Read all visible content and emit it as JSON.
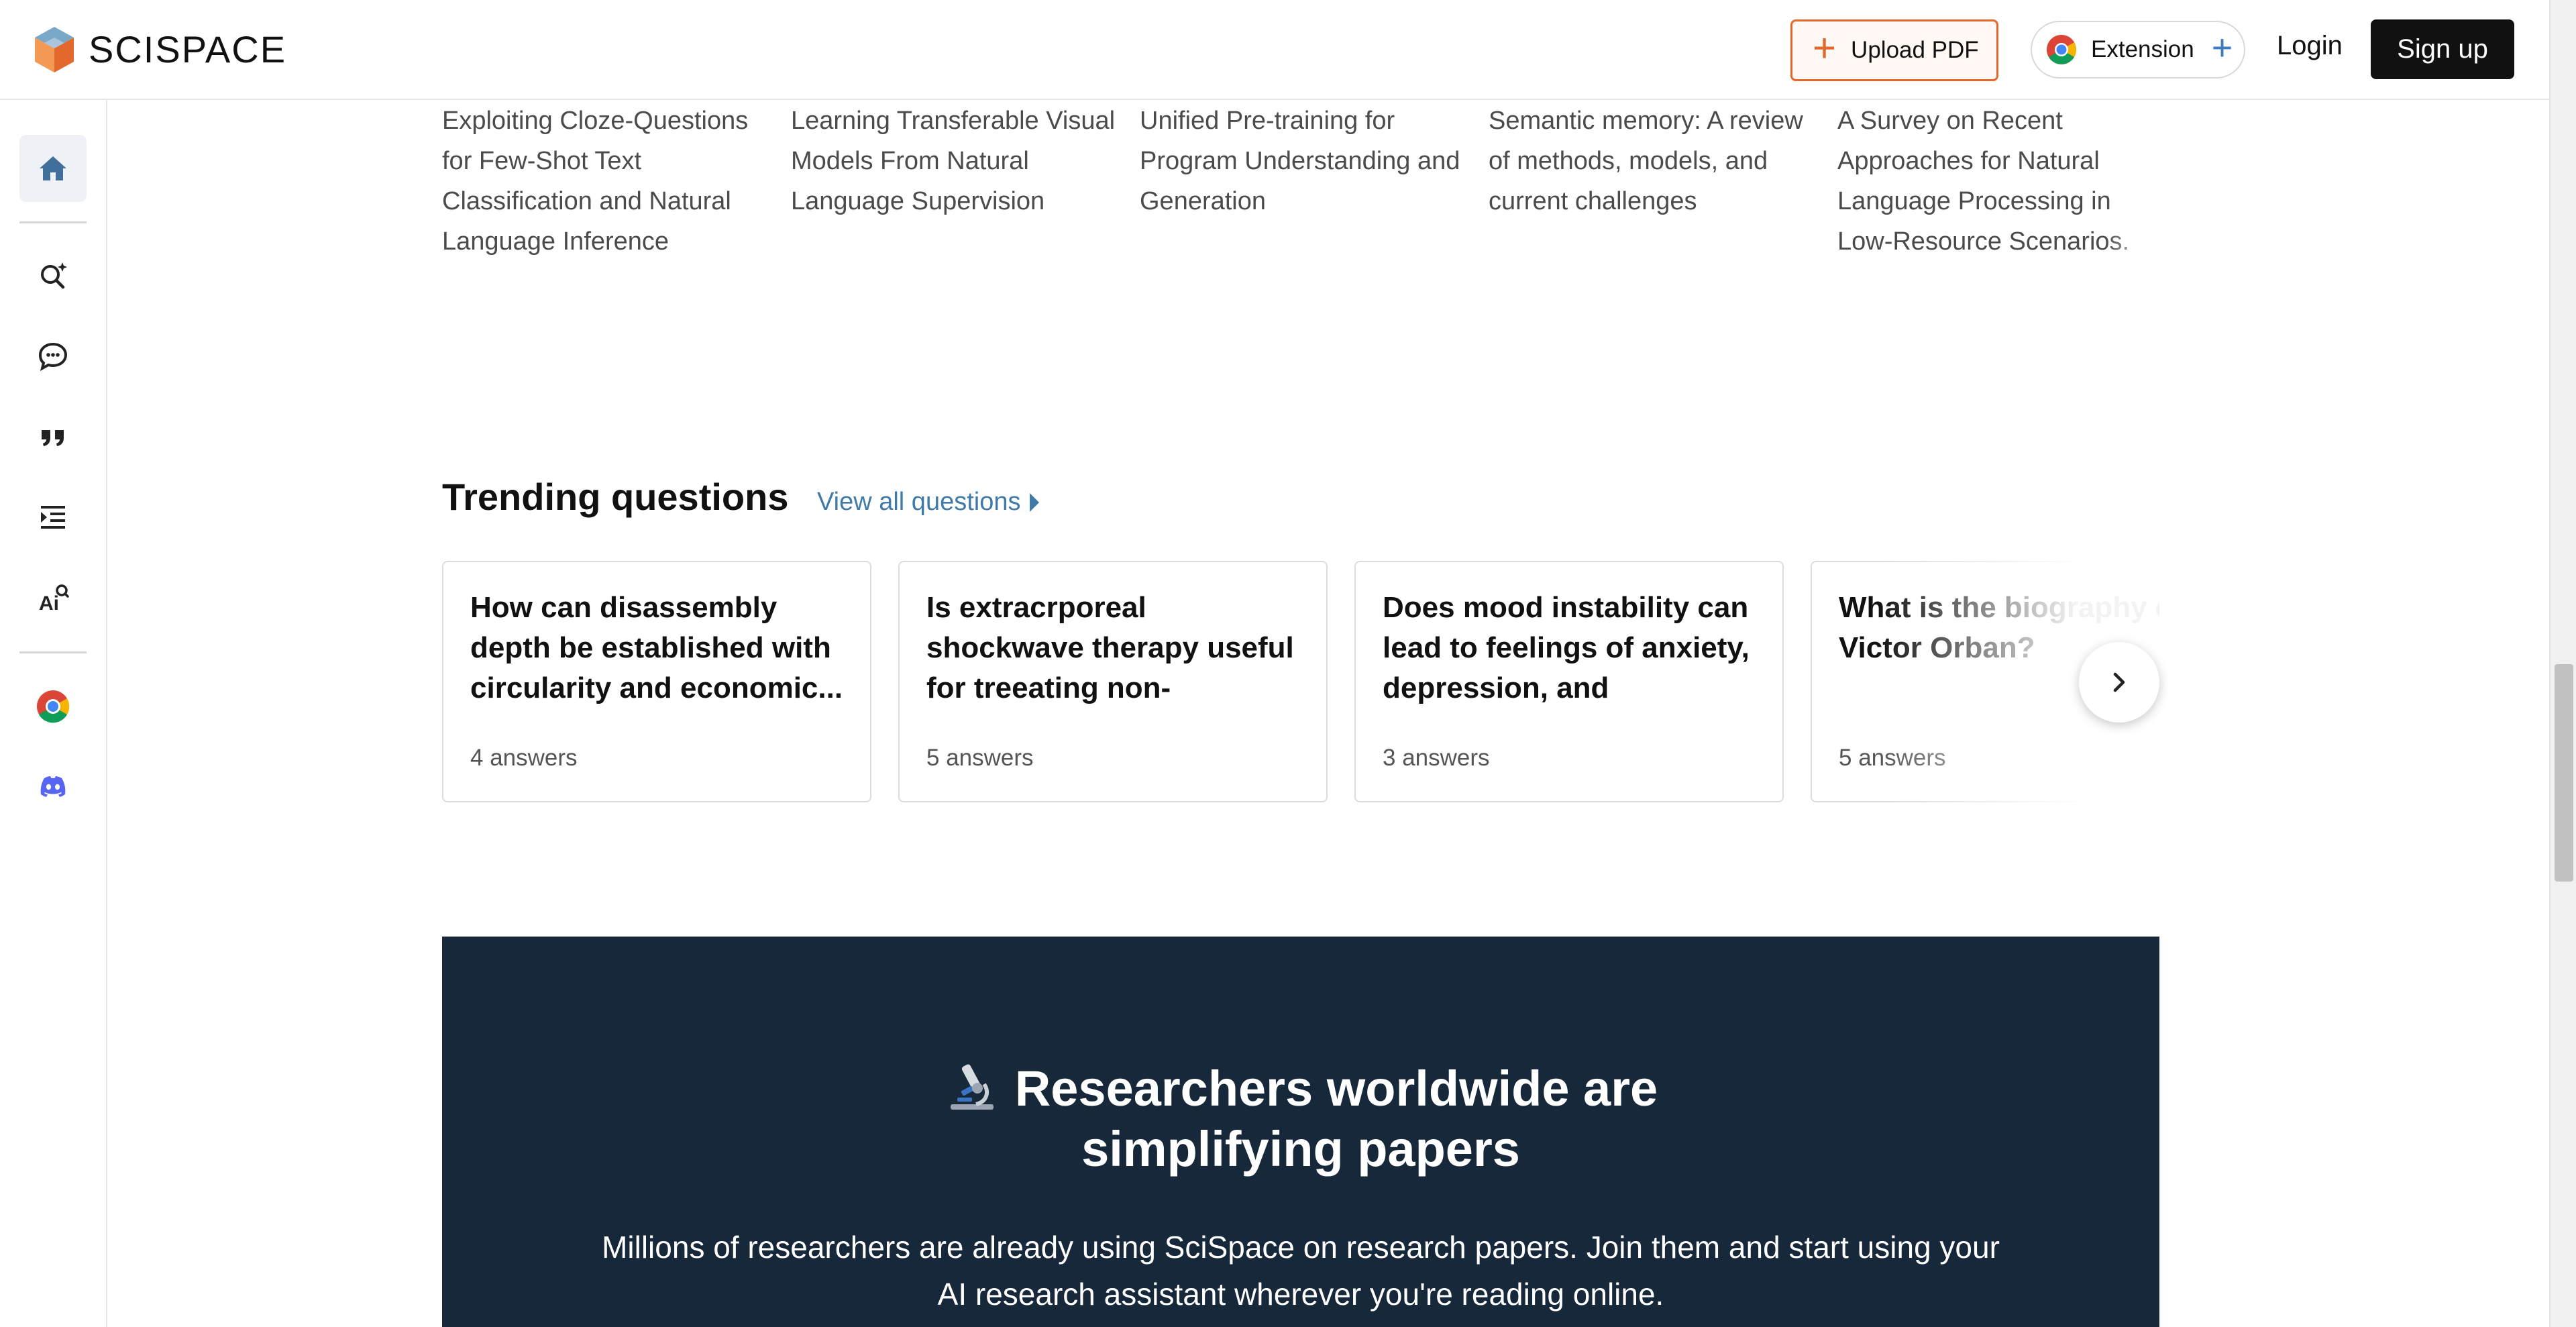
{
  "header": {
    "brand": "SCISPACE",
    "upload_label": "Upload PDF",
    "extension_label": "Extension",
    "login_label": "Login",
    "signup_label": "Sign up"
  },
  "sidebar": {
    "items": [
      {
        "name": "home-icon",
        "active": true
      },
      {
        "name": "literature-search-icon"
      },
      {
        "name": "chat-icon"
      },
      {
        "name": "citation-quote-icon"
      },
      {
        "name": "paraphrase-list-icon"
      },
      {
        "name": "ai-detector-icon"
      },
      {
        "name": "chrome-icon"
      },
      {
        "name": "discord-icon"
      }
    ]
  },
  "papers": [
    {
      "title": "Exploiting Cloze-Questions for Few-Shot Text Classification and Natural Language Inference"
    },
    {
      "title": "Learning Transferable Visual Models From Natural Language Supervision"
    },
    {
      "title": "Unified Pre-training for Program Understanding and Generation"
    },
    {
      "title": "Semantic memory: A review of methods, models, and current challenges"
    },
    {
      "title": "A Survey on Recent Approaches for Natural Language Processing in Low-Resource Scenarios."
    }
  ],
  "trending": {
    "title": "Trending questions",
    "view_all": "View all questions",
    "questions": [
      {
        "question": "How can disassembly depth be established with circularity and economic...",
        "answers": "4 answers"
      },
      {
        "question": "Is extracrporeal shockwave therapy useful for treeating non-traumatic chronic...",
        "answers": "5 answers"
      },
      {
        "question": "Does mood instability can lead to feelings of anxiety, depression, and decrease...",
        "answers": "3 answers"
      },
      {
        "question": "What is the biography of Victor Orban?",
        "answers": "5 answers"
      }
    ]
  },
  "banner": {
    "title_line1": "Researchers worldwide are",
    "title_line2": "simplifying papers",
    "subtitle_line1": "Millions of researchers are already using SciSpace on research papers. Join them and start using your",
    "subtitle_line2": "AI research assistant wherever you're reading online."
  },
  "colors": {
    "accent_orange": "#e2692b",
    "link_blue": "#3f7aa8",
    "banner_bg": "#16283a"
  }
}
